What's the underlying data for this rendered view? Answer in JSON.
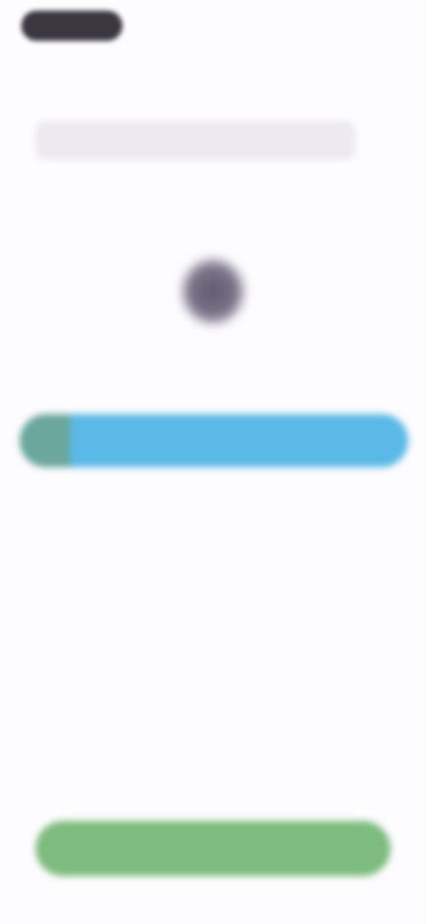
{
  "header": {
    "pill_label": ""
  },
  "message": {
    "text": ""
  },
  "avatar": {
    "icon": "avatar-icon"
  },
  "progress": {
    "value": 0.13,
    "label": ""
  },
  "footer": {
    "primary_button_label": ""
  },
  "colors": {
    "background": "#fdfcfe",
    "header_pill": "#3a3740",
    "message_bar": "#ebe8ef",
    "avatar": "#5f5a6c",
    "progress_track": "#5ab9e6",
    "progress_fill": "#6ba79c",
    "primary_button": "#7dbb7e"
  }
}
